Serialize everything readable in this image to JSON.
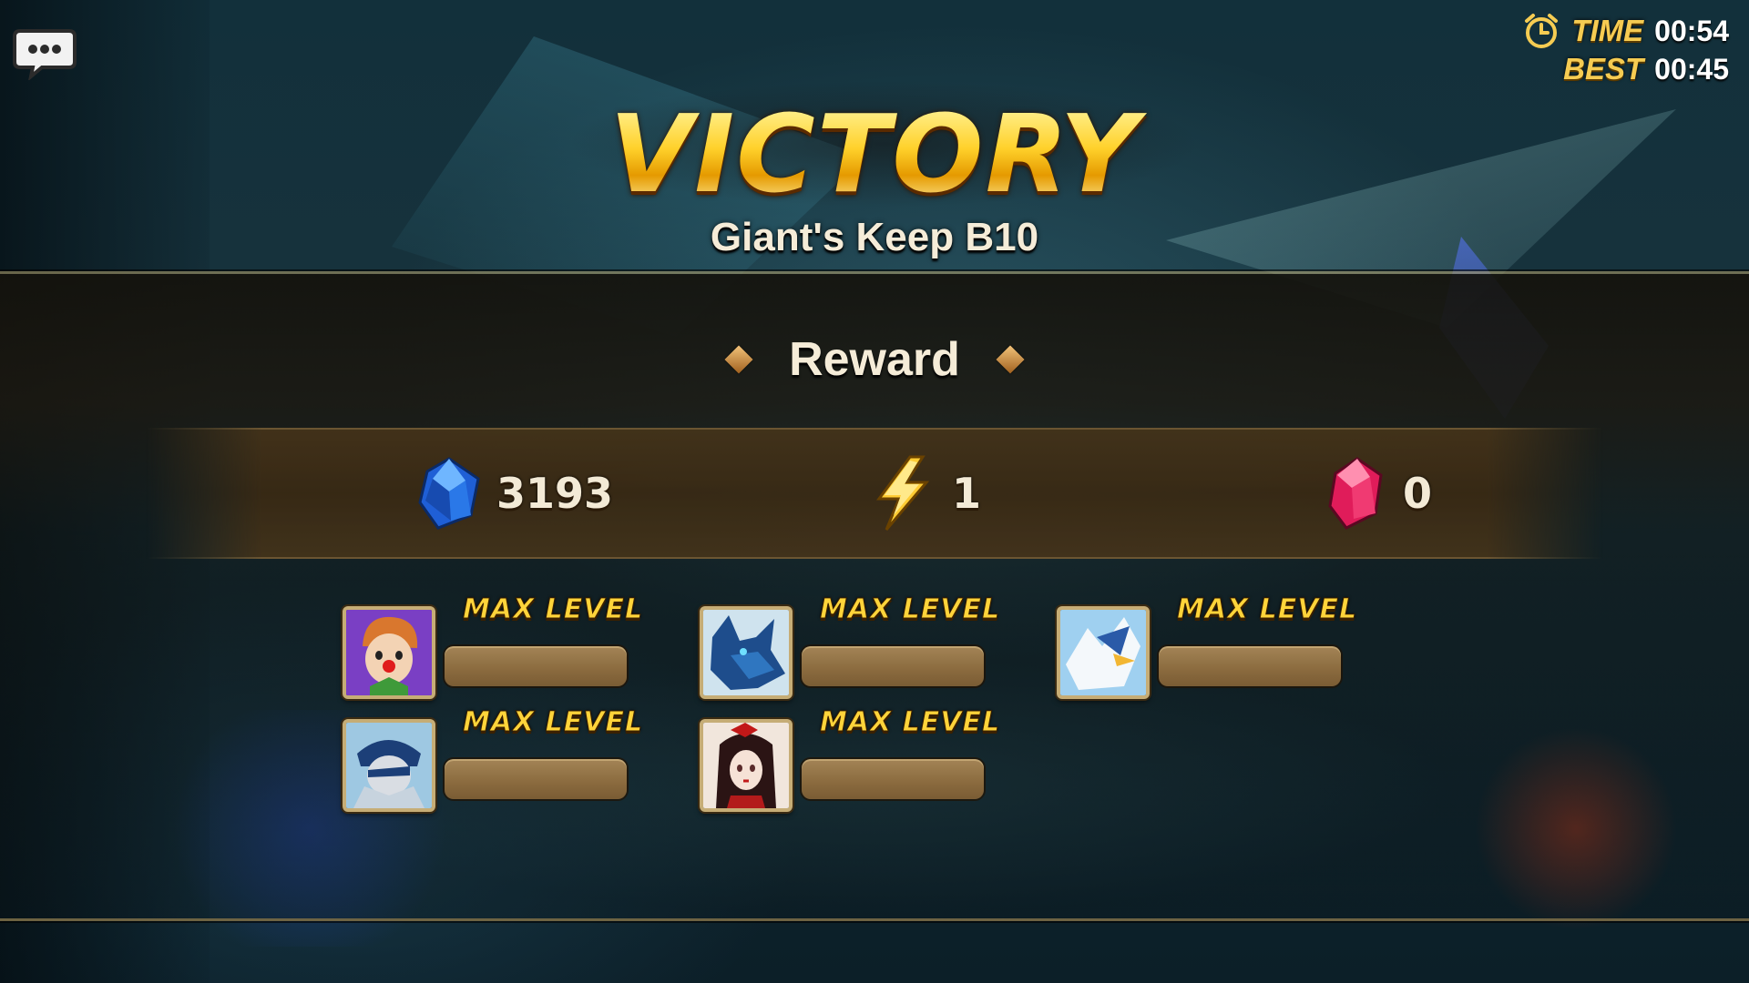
{
  "timer": {
    "time_label": "TIME",
    "time_value": "00:54",
    "best_label": "BEST",
    "best_value": "00:45"
  },
  "title": "VICTORY",
  "stage_name": "Giant's Keep B10",
  "reward": {
    "label": "Reward",
    "resources": [
      {
        "icon": "mana-crystal-icon",
        "value": "3193"
      },
      {
        "icon": "energy-bolt-icon",
        "value": "1"
      },
      {
        "icon": "red-crystal-icon",
        "value": "0"
      }
    ]
  },
  "monsters": [
    {
      "name": "clown-monster",
      "status": "MAX LEVEL",
      "exp_fraction": 1
    },
    {
      "name": "blue-wolf-monster",
      "status": "MAX LEVEL",
      "exp_fraction": 1
    },
    {
      "name": "white-griffon-monster",
      "status": "MAX LEVEL",
      "exp_fraction": 1
    },
    {
      "name": "blue-ninja-monster",
      "status": "MAX LEVEL",
      "exp_fraction": 1
    },
    {
      "name": "red-haired-woman-monster",
      "status": "MAX LEVEL",
      "exp_fraction": 1
    }
  ],
  "colors": {
    "title_gold": "#ffd234",
    "max_level_gold": "#ffd43a",
    "portrait_frame": "#c6ad76",
    "band_brown": "#3a2a14"
  }
}
